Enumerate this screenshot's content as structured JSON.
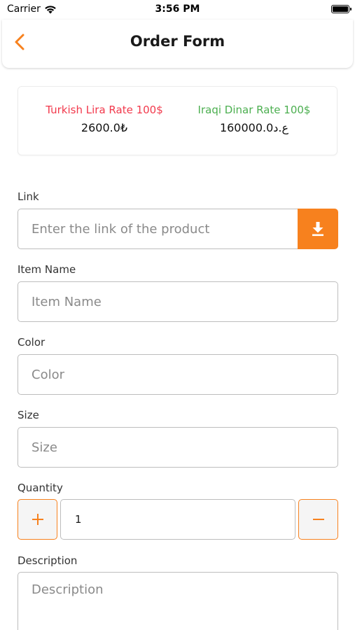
{
  "status_bar": {
    "carrier": "Carrier",
    "time": "3:56 PM",
    "wifi_icon": "wifi-icon",
    "battery_icon": "battery-icon"
  },
  "header": {
    "title": "Order Form",
    "back_icon": "chevron-left-icon"
  },
  "rates": {
    "lira": {
      "title": "Turkish Lira Rate 100$",
      "value": "2600.0₺",
      "color": "#f2394c"
    },
    "dinar": {
      "title": "Iraqi Dinar Rate 100$",
      "value": "160000.0ع.د",
      "color": "#4caf50"
    }
  },
  "form": {
    "link": {
      "label": "Link",
      "placeholder": "Enter the link of the product",
      "button_icon": "download-icon"
    },
    "item_name": {
      "label": "Item Name",
      "placeholder": "Item Name"
    },
    "color": {
      "label": "Color",
      "placeholder": "Color"
    },
    "size": {
      "label": "Size",
      "placeholder": "Size"
    },
    "quantity": {
      "label": "Quantity",
      "value": "1",
      "plus_icon": "plus-icon",
      "minus_icon": "minus-icon"
    },
    "description": {
      "label": "Description",
      "placeholder": "Description"
    }
  },
  "colors": {
    "accent": "#f7811e",
    "lira_red": "#f2394c",
    "dinar_green": "#4caf50",
    "border": "#bdbdbd"
  }
}
